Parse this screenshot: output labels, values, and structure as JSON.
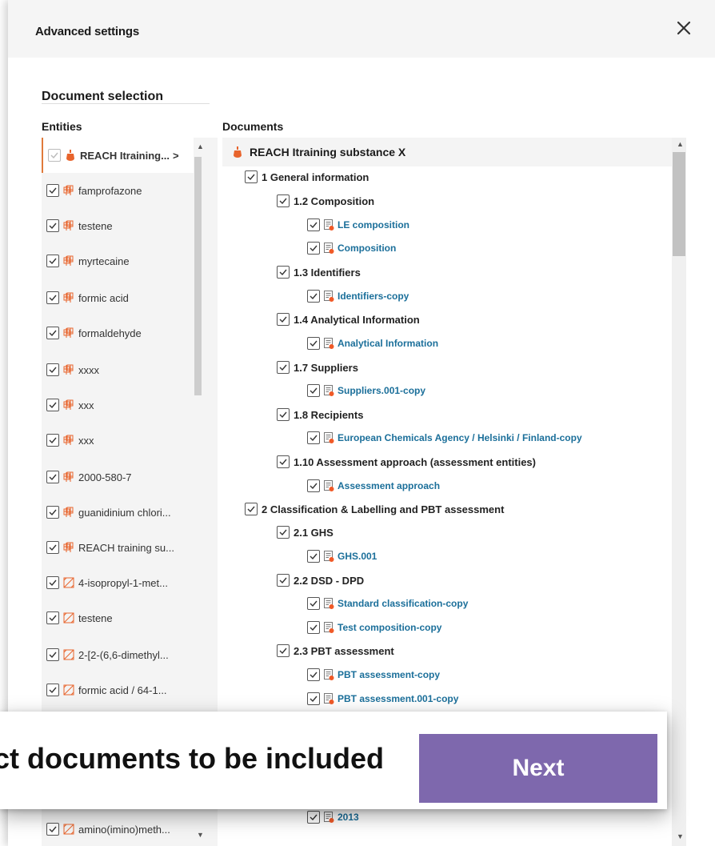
{
  "dialog": {
    "title": "Advanced settings",
    "close_icon": "close-icon"
  },
  "section_title": "Document selection",
  "entities": {
    "header": "Entities",
    "items": [
      {
        "label": "REACH Itraining...",
        "icon": "substance-icon",
        "selected": true,
        "disabled": true,
        "arrow": ">"
      },
      {
        "label": "famprofazone",
        "icon": "reference-substance-icon"
      },
      {
        "label": "testene",
        "icon": "reference-substance-icon"
      },
      {
        "label": "myrtecaine",
        "icon": "reference-substance-icon"
      },
      {
        "label": "formic acid",
        "icon": "reference-substance-icon"
      },
      {
        "label": "formaldehyde",
        "icon": "reference-substance-icon"
      },
      {
        "label": "xxxx",
        "icon": "reference-substance-icon"
      },
      {
        "label": "xxx",
        "icon": "reference-substance-icon"
      },
      {
        "label": "xxx",
        "icon": "reference-substance-icon"
      },
      {
        "label": "2000-580-7",
        "icon": "reference-substance-icon"
      },
      {
        "label": "guanidinium chlori...",
        "icon": "reference-substance-icon"
      },
      {
        "label": "REACH training su...",
        "icon": "reference-substance-icon"
      },
      {
        "label": "4-isopropyl-1-met...",
        "icon": "test-material-icon"
      },
      {
        "label": "testene",
        "icon": "test-material-icon"
      },
      {
        "label": "2-[2-(6,6-dimethyl...",
        "icon": "test-material-icon"
      },
      {
        "label": "formic acid / 64-1...",
        "icon": "test-material-icon"
      }
    ],
    "last_item": {
      "label": "amino(imino)meth...",
      "icon": "test-material-icon"
    }
  },
  "documents": {
    "header": "Documents",
    "root": "REACH Itraining substance X",
    "rows": [
      {
        "type": "sec",
        "level": 0,
        "label": "1 General information"
      },
      {
        "type": "sec",
        "level": 1,
        "label": "1.2 Composition"
      },
      {
        "type": "doc",
        "level": 2,
        "label": "LE composition"
      },
      {
        "type": "doc",
        "level": 2,
        "label": "Composition"
      },
      {
        "type": "sec",
        "level": 1,
        "label": "1.3 Identifiers"
      },
      {
        "type": "doc",
        "level": 2,
        "label": "Identifiers-copy"
      },
      {
        "type": "sec",
        "level": 1,
        "label": "1.4 Analytical Information"
      },
      {
        "type": "doc",
        "level": 2,
        "label": "Analytical Information"
      },
      {
        "type": "sec",
        "level": 1,
        "label": "1.7 Suppliers"
      },
      {
        "type": "doc",
        "level": 2,
        "label": "Suppliers.001-copy"
      },
      {
        "type": "sec",
        "level": 1,
        "label": "1.8 Recipients"
      },
      {
        "type": "doc",
        "level": 2,
        "label": "European Chemicals Agency / Helsinki / Finland-copy"
      },
      {
        "type": "sec",
        "level": 1,
        "label": "1.10 Assessment approach (assessment entities)"
      },
      {
        "type": "doc",
        "level": 2,
        "label": "Assessment approach"
      },
      {
        "type": "sec",
        "level": 0,
        "label": "2 Classification & Labelling and PBT assessment"
      },
      {
        "type": "sec",
        "level": 1,
        "label": "2.1 GHS"
      },
      {
        "type": "doc",
        "level": 2,
        "label": "GHS.001"
      },
      {
        "type": "sec",
        "level": 1,
        "label": "2.2 DSD - DPD"
      },
      {
        "type": "doc",
        "level": 2,
        "label": "Standard classification-copy"
      },
      {
        "type": "doc",
        "level": 2,
        "label": "Test composition-copy"
      },
      {
        "type": "sec",
        "level": 1,
        "label": "2.3 PBT assessment"
      },
      {
        "type": "doc",
        "level": 2,
        "label": "PBT assessment-copy"
      },
      {
        "type": "doc",
        "level": 2,
        "label": "PBT assessment.001-copy"
      }
    ],
    "last_row": {
      "type": "doc",
      "level": 2,
      "label": "2013"
    }
  },
  "callout": {
    "text": "ct documents to be included",
    "next_label": "Next"
  },
  "colors": {
    "accent": "#e07a3b",
    "link": "#1b6f9a",
    "button": "#7e68ad",
    "doc_badge": "#f05a28"
  }
}
